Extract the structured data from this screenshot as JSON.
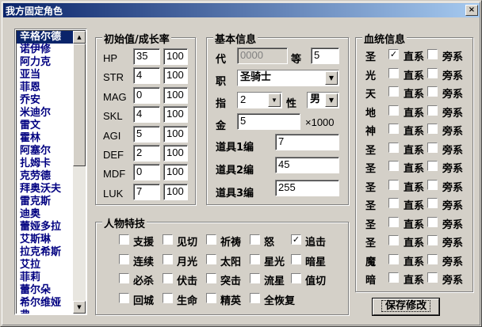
{
  "window": {
    "title": "我方固定角色",
    "close_glyph": "×"
  },
  "character_list": {
    "selected_index": 0,
    "items": [
      "辛格尔德",
      "诺伊修",
      "阿力克",
      "亚当",
      "菲恩",
      "乔安",
      "米迪尔",
      "雷文",
      "霍林",
      "阿塞尔",
      "扎姆卡",
      "克劳德",
      "拜奥沃夫",
      "雷克斯",
      "迪奥",
      "蕾娅多拉",
      "艾斯琳",
      "拉克希斯",
      "艾拉",
      "菲莉",
      "蕾尔朵",
      "希尔维娅",
      "弗"
    ]
  },
  "stats_group": {
    "title": "初始值/成长率",
    "rows": [
      {
        "label": "HP",
        "initial": "35",
        "growth": "100"
      },
      {
        "label": "STR",
        "initial": "4",
        "growth": "100"
      },
      {
        "label": "MAG",
        "initial": "0",
        "growth": "100"
      },
      {
        "label": "SKL",
        "initial": "4",
        "growth": "100"
      },
      {
        "label": "AGI",
        "initial": "5",
        "growth": "100"
      },
      {
        "label": "DEF",
        "initial": "2",
        "growth": "100"
      },
      {
        "label": "MDF",
        "initial": "0",
        "growth": "100"
      },
      {
        "label": "LUK",
        "initial": "7",
        "growth": "100"
      }
    ]
  },
  "basic_group": {
    "title": "基本信息",
    "generation_label": "代",
    "generation_value": "0000",
    "level_label": "等",
    "level_value": "5",
    "class_label": "职",
    "class_value": "圣骑士",
    "leader_label": "指",
    "leader_value": "2",
    "gender_label": "性",
    "gender_value": "男",
    "gold_label": "金",
    "gold_value": "5",
    "gold_unit": "×1000",
    "items": [
      {
        "label": "道具1编",
        "value": "7"
      },
      {
        "label": "道具2编",
        "value": "45"
      },
      {
        "label": "道具3编",
        "value": "255"
      }
    ]
  },
  "skills_group": {
    "title": "人物特技",
    "skills": [
      {
        "label": "支援",
        "checked": false
      },
      {
        "label": "见切",
        "checked": false
      },
      {
        "label": "祈祷",
        "checked": false
      },
      {
        "label": "怒",
        "checked": false
      },
      {
        "label": "追击",
        "checked": true
      },
      {
        "label": "连续",
        "checked": false
      },
      {
        "label": "月光",
        "checked": false
      },
      {
        "label": "太阳",
        "checked": false
      },
      {
        "label": "星光",
        "checked": false
      },
      {
        "label": "暗星",
        "checked": false
      },
      {
        "label": "必杀",
        "checked": false
      },
      {
        "label": "伏击",
        "checked": false
      },
      {
        "label": "突击",
        "checked": false
      },
      {
        "label": "流星",
        "checked": false
      },
      {
        "label": "值切",
        "checked": false
      },
      {
        "label": "回城",
        "checked": false
      },
      {
        "label": "生命",
        "checked": false
      },
      {
        "label": "精英",
        "checked": false
      },
      {
        "label": "全恢复",
        "checked": false
      }
    ]
  },
  "blood_group": {
    "title": "血统信息",
    "direct_label": "直系",
    "side_label": "旁系",
    "rows": [
      {
        "name": "圣",
        "direct": true,
        "side": false
      },
      {
        "name": "光",
        "direct": false,
        "side": false
      },
      {
        "name": "天",
        "direct": false,
        "side": false
      },
      {
        "name": "地",
        "direct": false,
        "side": false
      },
      {
        "name": "神",
        "direct": false,
        "side": false
      },
      {
        "name": "圣",
        "direct": false,
        "side": false
      },
      {
        "name": "圣",
        "direct": false,
        "side": false
      },
      {
        "name": "圣",
        "direct": false,
        "side": false
      },
      {
        "name": "圣",
        "direct": false,
        "side": false
      },
      {
        "name": "圣",
        "direct": false,
        "side": false
      },
      {
        "name": "圣",
        "direct": false,
        "side": false
      },
      {
        "name": "魔",
        "direct": false,
        "side": false
      },
      {
        "name": "暗",
        "direct": false,
        "side": false
      }
    ]
  },
  "save_button": {
    "label": "保存修改"
  }
}
